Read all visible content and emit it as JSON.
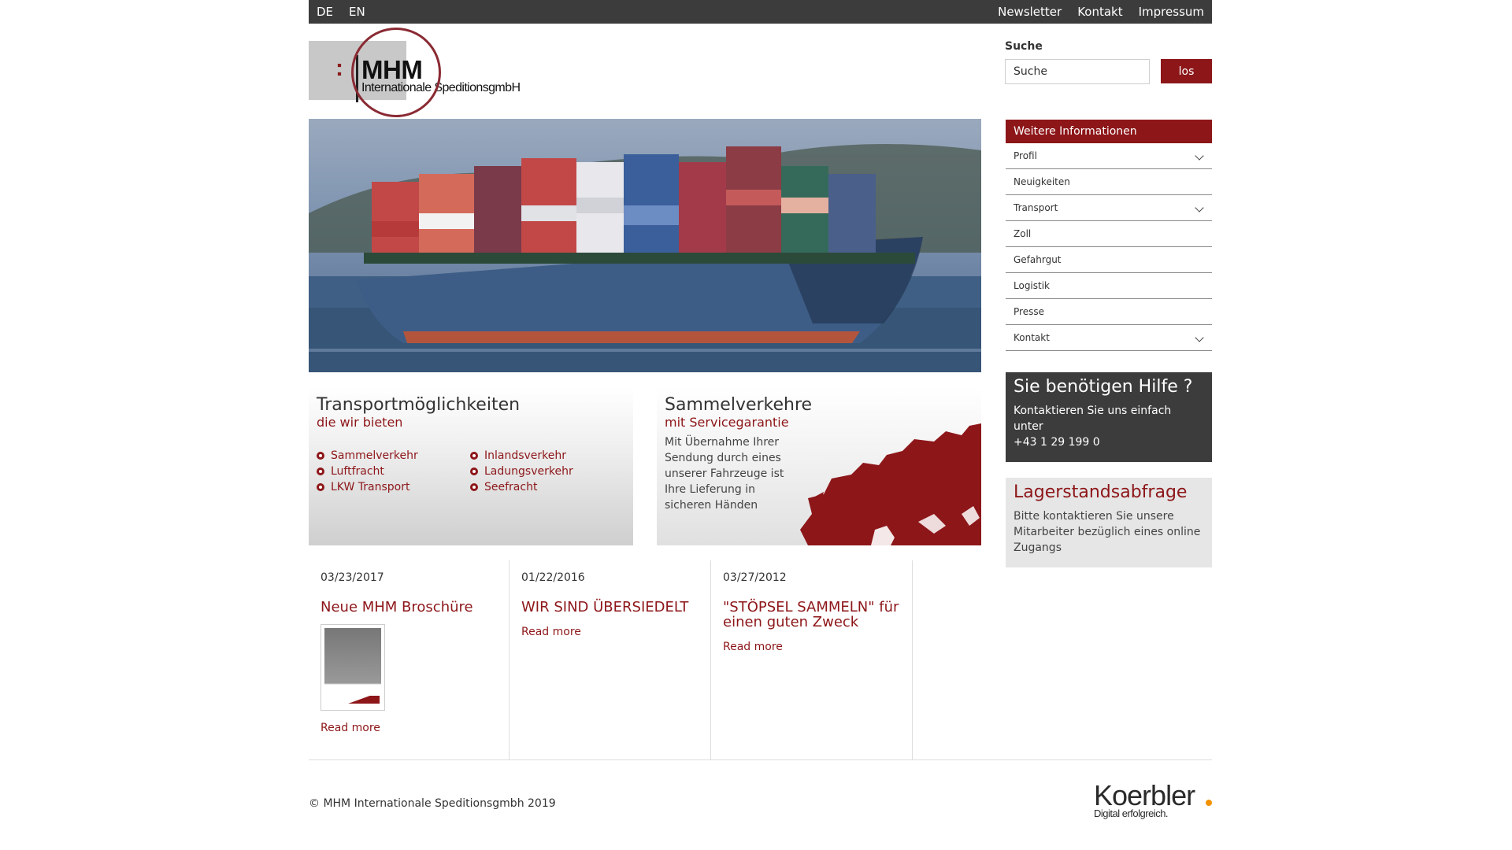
{
  "topbar": {
    "langs": [
      "DE",
      "EN"
    ],
    "links": [
      "Newsletter",
      "Kontakt",
      "Impressum"
    ]
  },
  "logo": {
    "mark": ":",
    "name": "MHM",
    "subtitle": "Internationale SpeditionsgmbH"
  },
  "search": {
    "label": "Suche",
    "value": "Suche",
    "button": "los"
  },
  "hero": {
    "image": "container-ship"
  },
  "sidebar": {
    "title": "Weitere Informationen",
    "items": [
      {
        "label": "Profil",
        "expandable": true
      },
      {
        "label": "Neuigkeiten",
        "expandable": false
      },
      {
        "label": "Transport",
        "expandable": true
      },
      {
        "label": "Zoll",
        "expandable": false
      },
      {
        "label": "Gefahrgut",
        "expandable": false
      },
      {
        "label": "Logistik",
        "expandable": false
      },
      {
        "label": "Presse",
        "expandable": false
      },
      {
        "label": "Kontakt",
        "expandable": true
      }
    ]
  },
  "help": {
    "title": "Sie benötigen Hilfe ?",
    "text": "Kontaktieren Sie uns einfach unter",
    "phone": "+43 1 29 199 0"
  },
  "lager": {
    "title": "Lagerstandsabfrage",
    "text": "Bitte kontaktieren Sie unsere Mitarbeiter bezüglich eines online Zugangs"
  },
  "transport": {
    "title": "Transportmöglichkeiten",
    "subtitle": "die wir bieten",
    "items": [
      "Sammelverkehr",
      "Inlandsverkehr",
      "Luftfracht",
      "Ladungsverkehr",
      "LKW Transport",
      "Seefracht"
    ]
  },
  "sammel": {
    "title": "Sammelverkehre",
    "subtitle": "mit Servicegarantie",
    "text": "Mit Übernahme Ihrer Sendung durch eines unserer Fahrzeuge ist Ihre Lieferung in sicheren Händen"
  },
  "news": [
    {
      "date": "03/23/2017",
      "title": "Neue MHM Broschüre",
      "more": "Read more"
    },
    {
      "date": "01/22/2016",
      "title": "WIR SIND ÜBERSIEDELT",
      "more": "Read more"
    },
    {
      "date": "03/27/2012",
      "title": "\"STÖPSEL SAMMELN\" für einen guten Zweck",
      "more": "Read more"
    }
  ],
  "footer": {
    "copyright": "© MHM Internationale Speditionsgmbh 2019",
    "partner_name": "Koerbler",
    "partner_tagline": "Digital erfolgreich."
  },
  "colors": {
    "brand": "#8d1619",
    "dark": "#3c3c3c"
  }
}
